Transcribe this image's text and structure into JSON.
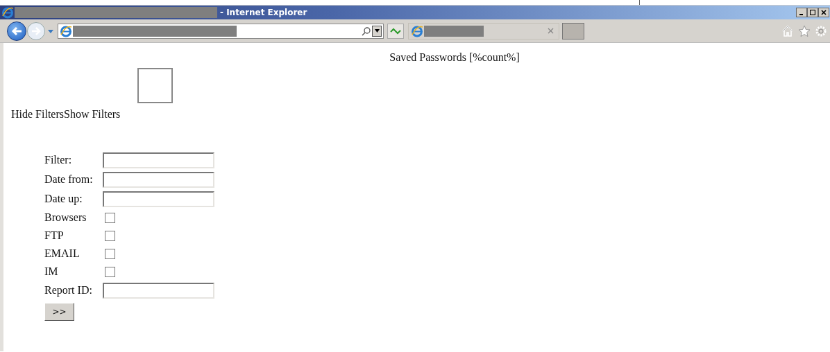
{
  "window": {
    "title": "- Internet Explorer"
  },
  "page": {
    "heading": "Saved Passwords [%count%]",
    "filter_toggle": "Hide FiltersShow Filters",
    "form": [
      {
        "kind": "field",
        "label": "Filter:"
      },
      {
        "kind": "field",
        "label": "Date from:"
      },
      {
        "kind": "field",
        "label": "Date up:"
      },
      {
        "kind": "checkbox",
        "label": "Browsers",
        "checked": false
      },
      {
        "kind": "checkbox",
        "label": "FTP",
        "checked": false
      },
      {
        "kind": "checkbox",
        "label": "EMAIL",
        "checked": false
      },
      {
        "kind": "checkbox",
        "label": "IM",
        "checked": false
      },
      {
        "kind": "field",
        "label": "Report ID:"
      }
    ],
    "submit": ">>"
  }
}
